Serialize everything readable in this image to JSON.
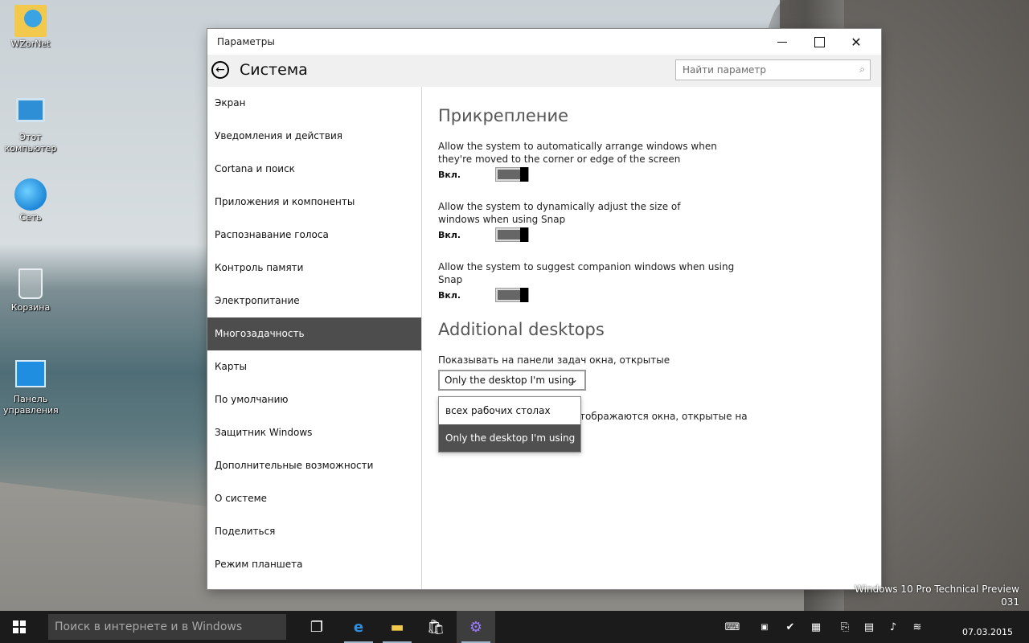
{
  "desktop": {
    "icons": [
      {
        "label": "WZorNet"
      },
      {
        "label": "Этот компьютер"
      },
      {
        "label": "Сеть"
      },
      {
        "label": "Корзина"
      },
      {
        "label": "Панель управления"
      }
    ],
    "watermark_line1": "Windows 10 Pro Technical Preview",
    "watermark_line2": "031"
  },
  "window": {
    "title": "Параметры",
    "page_title": "Система",
    "search_placeholder": "Найти параметр"
  },
  "sidebar": {
    "items": [
      {
        "label": "Экран"
      },
      {
        "label": "Уведомления и действия"
      },
      {
        "label": "Cortana и поиск"
      },
      {
        "label": "Приложения и компоненты"
      },
      {
        "label": "Распознавание голоса"
      },
      {
        "label": "Контроль памяти"
      },
      {
        "label": "Электропитание"
      },
      {
        "label": "Многозадачность"
      },
      {
        "label": "Карты"
      },
      {
        "label": "По умолчанию"
      },
      {
        "label": "Защитник Windows"
      },
      {
        "label": "Дополнительные возможности"
      },
      {
        "label": "О системе"
      },
      {
        "label": "Поделиться"
      },
      {
        "label": "Режим планшета"
      }
    ],
    "active_label": "Многозадачность"
  },
  "snap": {
    "heading": "Прикрепление",
    "options": [
      {
        "desc": "Allow the system to automatically arrange windows when they're moved to the corner or edge of the screen",
        "state": "Вкл."
      },
      {
        "desc": "Allow the system to dynamically adjust the size of windows when using Snap",
        "state": "Вкл."
      },
      {
        "desc": "Allow the system to suggest companion windows when using Snap",
        "state": "Вкл."
      }
    ]
  },
  "desktops": {
    "heading": "Additional desktops",
    "taskbar_label": "Показывать на панели задач окна, открытые на",
    "taskbar_value": "Only the desktop I'm using",
    "alttab_label_partial": "тображаются окна, открытые на",
    "dropdown_options": [
      "всех рабочих столах",
      "Only the desktop I'm using"
    ],
    "dropdown_selected": "Only the desktop I'm using"
  },
  "taskbar": {
    "search_placeholder": "Поиск в интернете и в Windows",
    "apps": [
      "task-view",
      "edge",
      "file-explorer",
      "store",
      "settings"
    ],
    "clock_date": "07.03.2015"
  },
  "colors": {
    "active_nav": "#4d4d4d",
    "dropdown_selected": "#505050",
    "taskbar": "#1b1b1b"
  }
}
